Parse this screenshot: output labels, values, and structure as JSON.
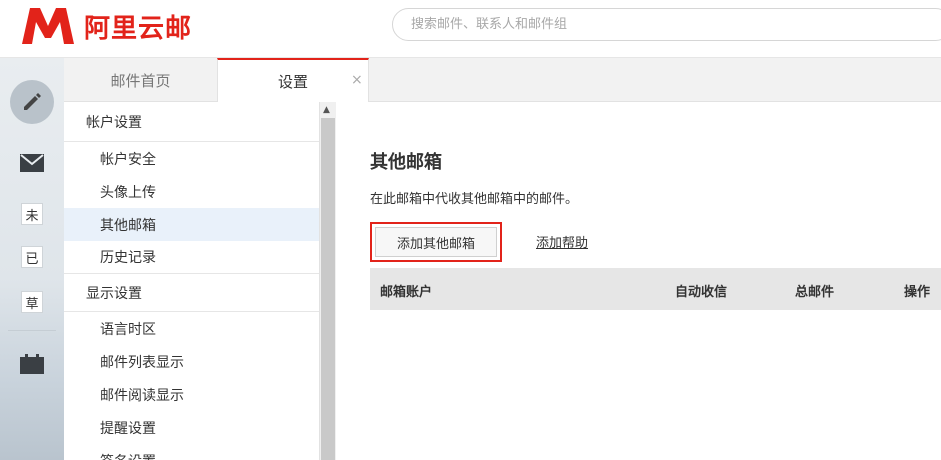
{
  "header": {
    "brand": "阿里云邮",
    "search_placeholder": "搜索邮件、联系人和邮件组"
  },
  "rail": {
    "unread_label": "未",
    "read_label": "已",
    "draft_label": "草"
  },
  "tabs": [
    {
      "label": "邮件首页"
    },
    {
      "label": "设置"
    }
  ],
  "tab_close": "×",
  "nav": {
    "sections": [
      {
        "title": "帐户设置",
        "items": [
          "帐户安全",
          "头像上传",
          "其他邮箱",
          "历史记录"
        ]
      },
      {
        "title": "显示设置",
        "items": [
          "语言时区",
          "邮件列表显示",
          "邮件阅读显示",
          "提醒设置",
          "签名设置"
        ]
      }
    ],
    "active_item": "其他邮箱"
  },
  "main": {
    "title": "其他邮箱",
    "description": "在此邮箱中代收其他邮箱中的邮件。",
    "add_button": "添加其他邮箱",
    "help_link": "添加帮助",
    "columns": [
      "邮箱账户",
      "自动收信",
      "总邮件",
      "操作"
    ]
  },
  "colors": {
    "brand_red": "#e2231a",
    "active_nav_bg": "#e9f1fa"
  }
}
